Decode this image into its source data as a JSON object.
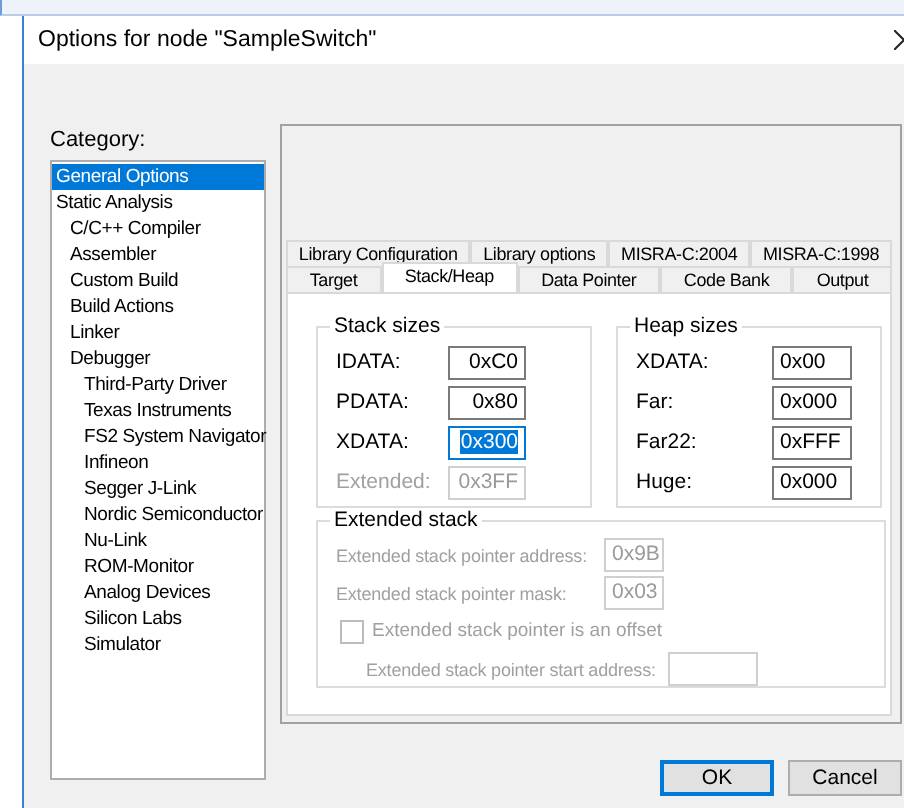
{
  "window": {
    "title": "Options for node \"SampleSwitch\""
  },
  "category": {
    "label": "Category:",
    "items": [
      {
        "label": "General Options",
        "selected": true
      },
      {
        "label": "Static Analysis",
        "selected": false,
        "children": [
          {
            "label": "C/C++ Compiler",
            "selected": false
          },
          {
            "label": "Assembler",
            "selected": false
          },
          {
            "label": "Custom Build",
            "selected": false
          },
          {
            "label": "Build Actions",
            "selected": false
          },
          {
            "label": "Linker",
            "selected": false
          },
          {
            "label": "Debugger",
            "selected": false,
            "children": [
              {
                "label": "Third-Party Driver",
                "selected": false
              },
              {
                "label": "Texas Instruments",
                "selected": false
              },
              {
                "label": "FS2 System Navigator",
                "selected": false
              },
              {
                "label": "Infineon",
                "selected": false
              },
              {
                "label": "Segger J-Link",
                "selected": false
              },
              {
                "label": "Nordic Semiconductor",
                "selected": false
              },
              {
                "label": "Nu-Link",
                "selected": false
              },
              {
                "label": "ROM-Monitor",
                "selected": false
              },
              {
                "label": "Analog Devices",
                "selected": false
              },
              {
                "label": "Silicon Labs",
                "selected": false
              },
              {
                "label": "Simulator",
                "selected": false
              }
            ]
          }
        ]
      }
    ]
  },
  "tab_rows": [
    [
      {
        "label": "Library Configuration",
        "selected": false
      },
      {
        "label": "Library options",
        "selected": false
      },
      {
        "label": "MISRA-C:2004",
        "selected": false
      },
      {
        "label": "MISRA-C:1998",
        "selected": false
      }
    ],
    [
      {
        "label": "Target",
        "selected": false
      },
      {
        "label": "Stack/Heap",
        "selected": true
      },
      {
        "label": "Data Pointer",
        "selected": false
      },
      {
        "label": "Code Bank",
        "selected": false
      },
      {
        "label": "Output",
        "selected": false
      }
    ]
  ],
  "stack_sizes": {
    "title": "Stack sizes",
    "fields": [
      {
        "label": "IDATA:",
        "value": "0xC0",
        "disabled": false,
        "text_selected": false
      },
      {
        "label": "PDATA:",
        "value": "0x80",
        "disabled": false,
        "text_selected": false
      },
      {
        "label": "XDATA:",
        "value": "0x300",
        "disabled": false,
        "text_selected": true
      },
      {
        "label": "Extended:",
        "value": "0x3FF",
        "disabled": true,
        "text_selected": false
      }
    ]
  },
  "heap_sizes": {
    "title": "Heap sizes",
    "fields": [
      {
        "label": "XDATA:",
        "value": "0x00"
      },
      {
        "label": "Far:",
        "value": "0x000"
      },
      {
        "label": "Far22:",
        "value": "0xFFF"
      },
      {
        "label": "Huge:",
        "value": "0x000"
      }
    ]
  },
  "extended_stack": {
    "title": "Extended stack",
    "disabled": true,
    "address": {
      "label": "Extended stack pointer address:",
      "value": "0x9B"
    },
    "mask": {
      "label": "Extended stack pointer mask:",
      "value": "0x03"
    },
    "offset": {
      "label": "Extended stack pointer is an offset",
      "checked": false
    },
    "start_address": {
      "label": "Extended stack pointer start address:"
    }
  },
  "buttons": [
    {
      "label": "OK",
      "default": true
    },
    {
      "label": "Cancel",
      "default": false
    }
  ]
}
